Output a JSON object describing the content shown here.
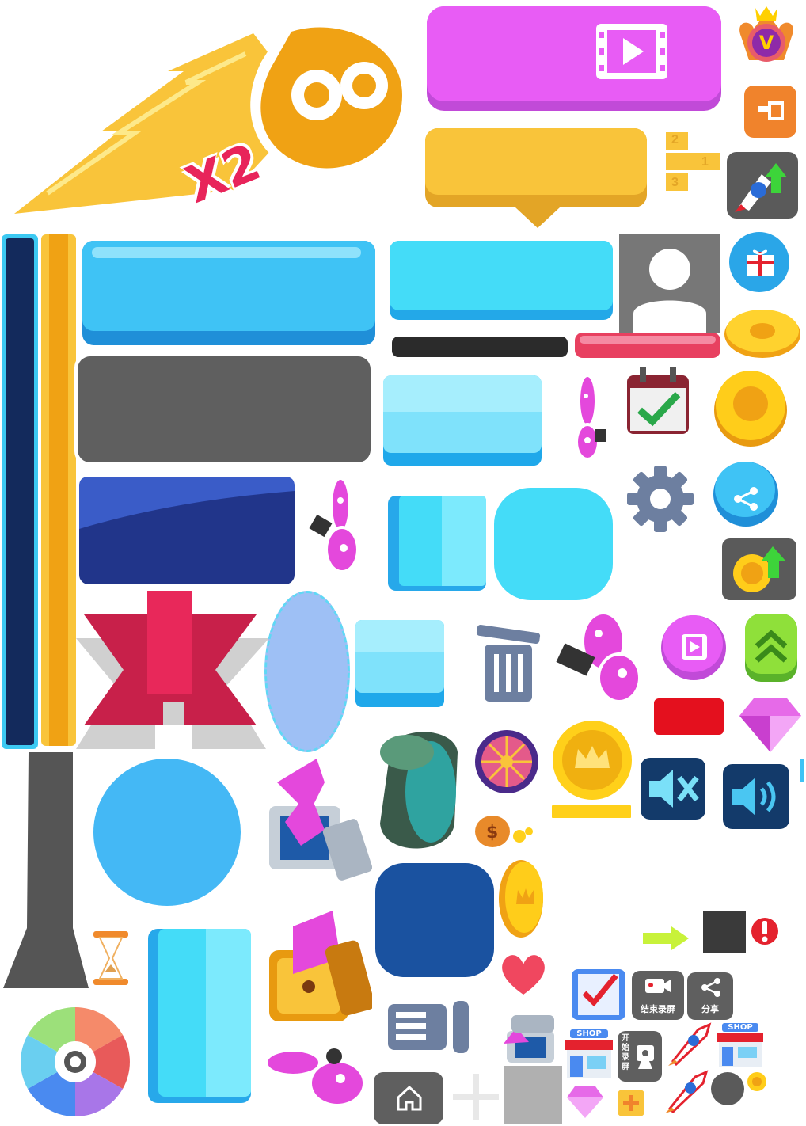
{
  "sheet": {
    "badge_text": "X2",
    "vip_letter": "V",
    "podium_numbers": [
      "2",
      "1",
      "3"
    ],
    "end_record_label": "结束录屏",
    "share_label": "分享",
    "start_record_label": "开始录屏",
    "shop_label": "SHOP",
    "shop_label_2": "SHOP"
  },
  "colors": {
    "sky": "#3fc3f5",
    "sky_dark": "#1f8fd8",
    "magenta": "#e85cf0",
    "yellow": "#f9c43a",
    "orange": "#f08a2c",
    "navy": "#132a5c",
    "red": "#e4222e",
    "gray": "#606060"
  },
  "icons": [
    "double-coin-icon",
    "vip-crown-icon",
    "video-play-icon",
    "exit-icon",
    "podium-icon",
    "rocket-upgrade-icon",
    "user-avatar-icon",
    "gift-icon",
    "coin-icon",
    "calendar-check-icon",
    "settings-gear-icon",
    "share-icon",
    "coin-upgrade-icon",
    "trash-icon",
    "butterfly-icon",
    "video-orb-icon",
    "chevron-up-icon",
    "diamond-icon",
    "lucky-wheel-icon",
    "crown-coin-icon",
    "mute-icon",
    "sound-on-icon",
    "money-bag-icon",
    "treasure-chest-icon",
    "hourglass-icon",
    "aperture-icon",
    "heart-icon",
    "arrow-right-icon",
    "alert-icon",
    "home-icon",
    "plus-icon",
    "shop-icon",
    "record-icon",
    "scroll-check-icon"
  ]
}
